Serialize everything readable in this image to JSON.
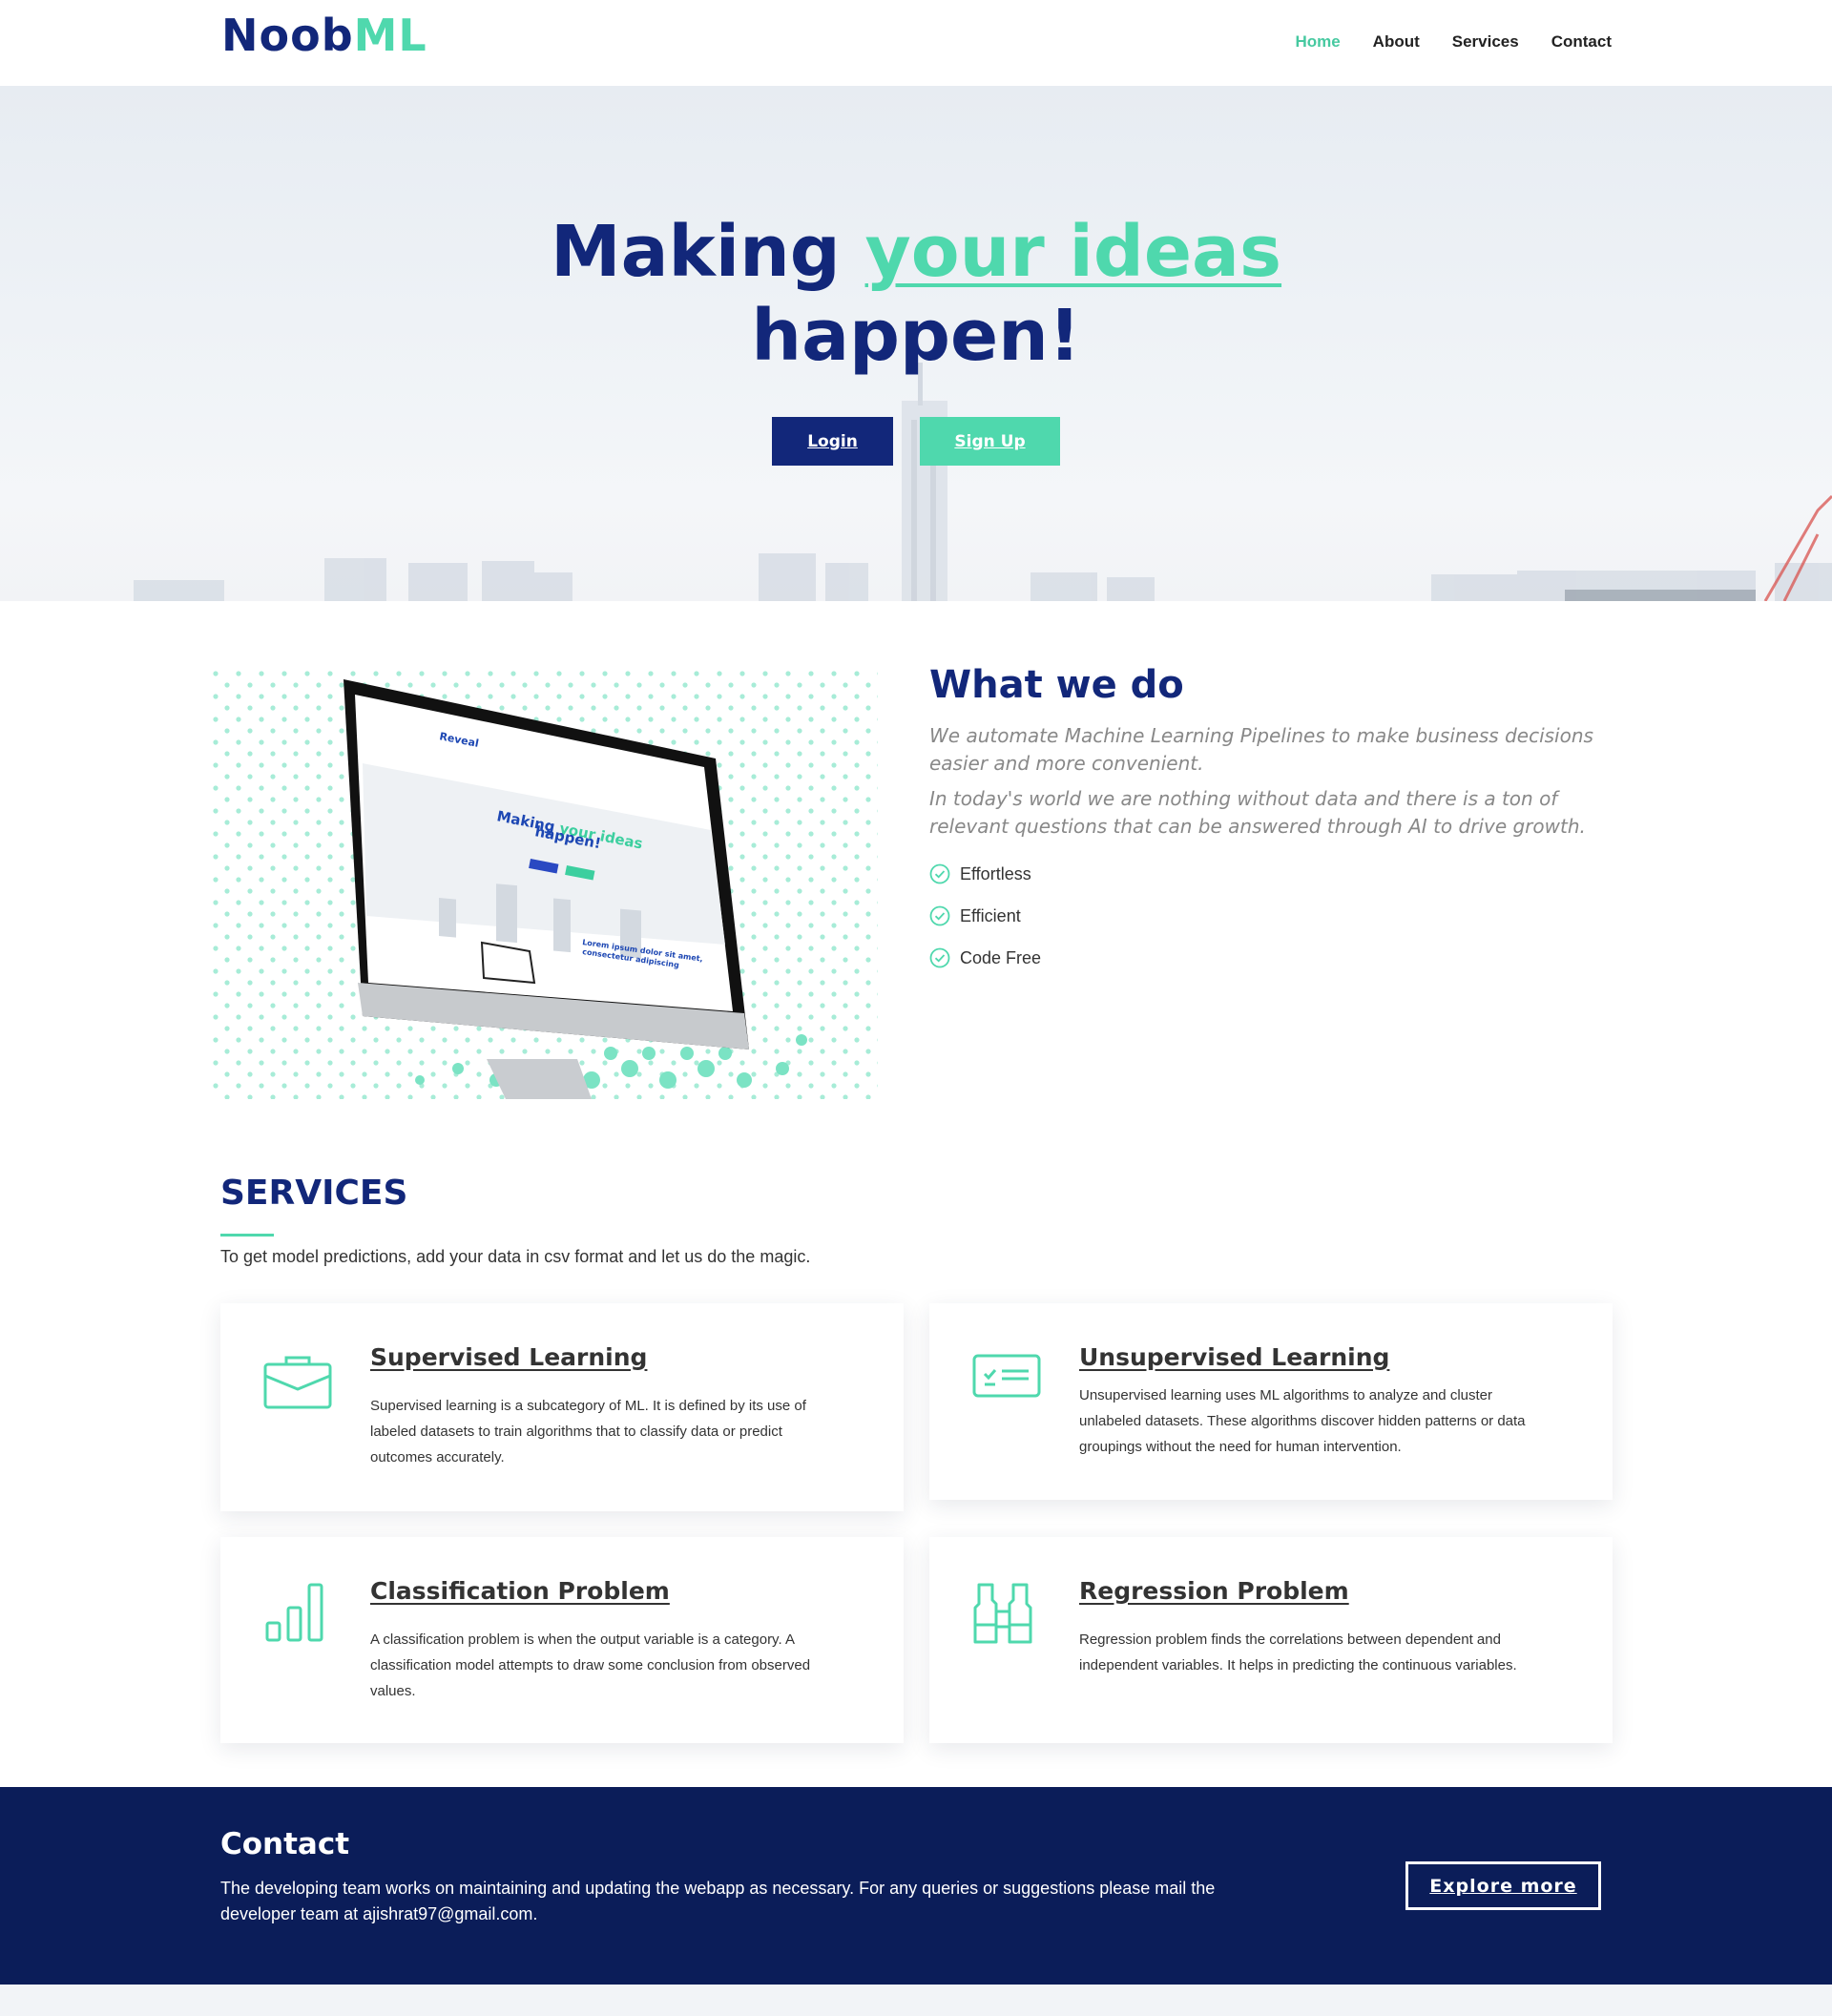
{
  "header": {
    "logo_part1": "Noob",
    "logo_part2": "ML",
    "nav": [
      "Home",
      "About",
      "Services",
      "Contact"
    ],
    "active_nav": "Home"
  },
  "hero": {
    "title_line1_part1": "Making ",
    "title_line1_accent": "your ideas",
    "title_line2": "happen!",
    "login_label": "Login",
    "signup_label": "Sign Up"
  },
  "what_we_do": {
    "title": "What we do",
    "paragraph1": "We automate Machine Learning Pipelines to make business decisions easier and more convenient.",
    "paragraph2": "In today's world we are nothing without data and there is a ton of relevant questions that can be answered through AI to drive growth.",
    "features": [
      "Effortless",
      "Efficient",
      "Code Free"
    ],
    "mockup": {
      "brand": "Reveal",
      "headline_part1": "Making ",
      "headline_accent": "your ideas",
      "headline_line2": "happen!",
      "lorem_line1": "Lorem ipsum dolor sit amet,",
      "lorem_line2": "consectetur adipiscing"
    }
  },
  "services": {
    "title": "SERVICES",
    "subtitle": "To get model predictions, add your data in csv format and let us do the magic.",
    "cards": [
      {
        "icon": "briefcase-icon",
        "title": "Supervised Learning",
        "text": "Supervised learning is a subcategory of ML. It is defined by its use of labeled datasets to train algorithms that to classify data or predict outcomes accurately."
      },
      {
        "icon": "checklist-card-icon",
        "title": "Unsupervised Learning",
        "text": "Unsupervised learning uses ML algorithms to analyze and cluster unlabeled datasets. These algorithms discover hidden patterns or data groupings without the need for human intervention."
      },
      {
        "icon": "bar-chart-icon",
        "title": "Classification Problem",
        "text": "A classification problem is when the output variable is a category. A classification model attempts to draw some conclusion from observed values."
      },
      {
        "icon": "binoculars-icon",
        "title": "Regression Problem",
        "text": "Regression problem finds the correlations between dependent and independent variables. It helps in predicting the continuous variables."
      }
    ]
  },
  "contact": {
    "title": "Contact",
    "text": "The developing team works on maintaining and updating the webapp as necessary. For any queries or suggestions please mail the developer team at ajishrat97@gmail.com.",
    "explore_label": "Explore more"
  },
  "colors": {
    "primary": "#12277a",
    "accent": "#4fd8ad",
    "contact_bg": "#0b1d59"
  }
}
